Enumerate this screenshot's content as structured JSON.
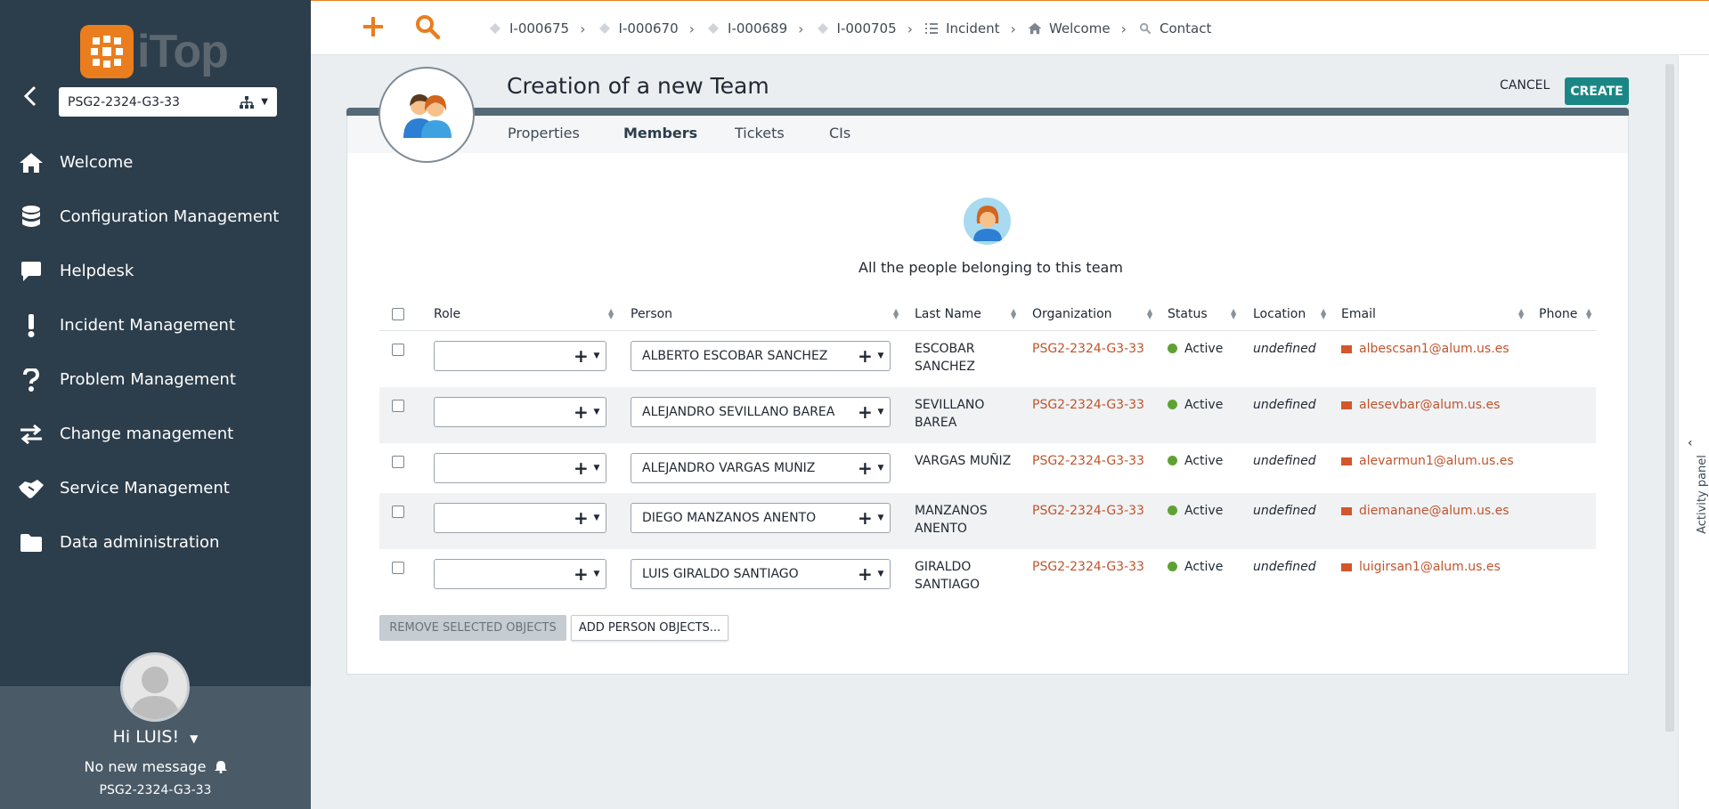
{
  "sidebar": {
    "logo_text": "iTop",
    "org_select": {
      "value": "PSG2-2324-G3-33"
    },
    "menu": [
      {
        "label": "Welcome",
        "icon": "home-icon"
      },
      {
        "label": "Configuration Management",
        "icon": "database-icon"
      },
      {
        "label": "Helpdesk",
        "icon": "chat-bubble-icon"
      },
      {
        "label": "Incident Management",
        "icon": "exclamation-icon"
      },
      {
        "label": "Problem Management",
        "icon": "question-icon"
      },
      {
        "label": "Change management",
        "icon": "exchange-arrows-icon"
      },
      {
        "label": "Service Management",
        "icon": "handshake-icon"
      },
      {
        "label": "Data administration",
        "icon": "folder-icon"
      }
    ],
    "user": {
      "greeting": "Hi LUIS!",
      "messages": "No new message",
      "org": "PSG2-2324-G3-33"
    }
  },
  "topbar": {
    "breadcrumbs": [
      {
        "label": "I-000675",
        "icon": "ticket-icon"
      },
      {
        "label": "I-000670",
        "icon": "ticket-icon"
      },
      {
        "label": "I-000689",
        "icon": "ticket-icon"
      },
      {
        "label": "I-000705",
        "icon": "ticket-icon"
      },
      {
        "label": "Incident",
        "icon": "list-icon"
      },
      {
        "label": "Welcome",
        "icon": "home-icon"
      },
      {
        "label": "Contact",
        "icon": "search-icon"
      }
    ]
  },
  "page": {
    "title": "Creation of a new Team",
    "cancel_label": "CANCEL",
    "create_label": "CREATE",
    "tabs": [
      "Properties",
      "Members",
      "Tickets",
      "CIs"
    ],
    "active_tab": "Members",
    "list_description": "All the people belonging to this team"
  },
  "table": {
    "headers": {
      "role": "Role",
      "person": "Person",
      "last_name": "Last Name",
      "organization": "Organization",
      "status": "Status",
      "location": "Location",
      "email": "Email",
      "phone": "Phone"
    },
    "rows": [
      {
        "role": "",
        "person": "ALBERTO ESCOBAR SANCHEZ",
        "last_name_1": "ESCOBAR",
        "last_name_2": "SANCHEZ",
        "organization": "PSG2-2324-G3-33",
        "status": "Active",
        "location": "undefined",
        "email": "albescsan1@alum.us.es",
        "phone": ""
      },
      {
        "role": "",
        "person": "ALEJANDRO SEVILLANO BAREA",
        "last_name_1": "SEVILLANO",
        "last_name_2": "BAREA",
        "organization": "PSG2-2324-G3-33",
        "status": "Active",
        "location": "undefined",
        "email": "alesevbar@alum.us.es",
        "phone": ""
      },
      {
        "role": "",
        "person": "ALEJANDRO VARGAS MUÑIZ",
        "last_name_1": "VARGAS MUÑIZ",
        "last_name_2": "",
        "organization": "PSG2-2324-G3-33",
        "status": "Active",
        "location": "undefined",
        "email": "alevarmun1@alum.us.es",
        "phone": ""
      },
      {
        "role": "",
        "person": "DIEGO MANZANOS ANENTO",
        "last_name_1": "MANZANOS",
        "last_name_2": "ANENTO",
        "organization": "PSG2-2324-G3-33",
        "status": "Active",
        "location": "undefined",
        "email": "diemanane@alum.us.es",
        "phone": ""
      },
      {
        "role": "",
        "person": "LUIS GIRALDO SANTIAGO",
        "last_name_1": "GIRALDO",
        "last_name_2": "SANTIAGO",
        "organization": "PSG2-2324-G3-33",
        "status": "Active",
        "location": "undefined",
        "email": "luigirsan1@alum.us.es",
        "phone": ""
      }
    ],
    "remove_label": "REMOVE SELECTED OBJECTS",
    "add_label": "ADD PERSON OBJECTS..."
  },
  "activity_panel": {
    "label": "Activity panel"
  },
  "colors": {
    "sidebar_bg": "#2c3d4b",
    "accent_orange": "#ea7d1e",
    "create_button": "#1b8784",
    "link": "#c0542d",
    "status_active": "#5fa233"
  }
}
